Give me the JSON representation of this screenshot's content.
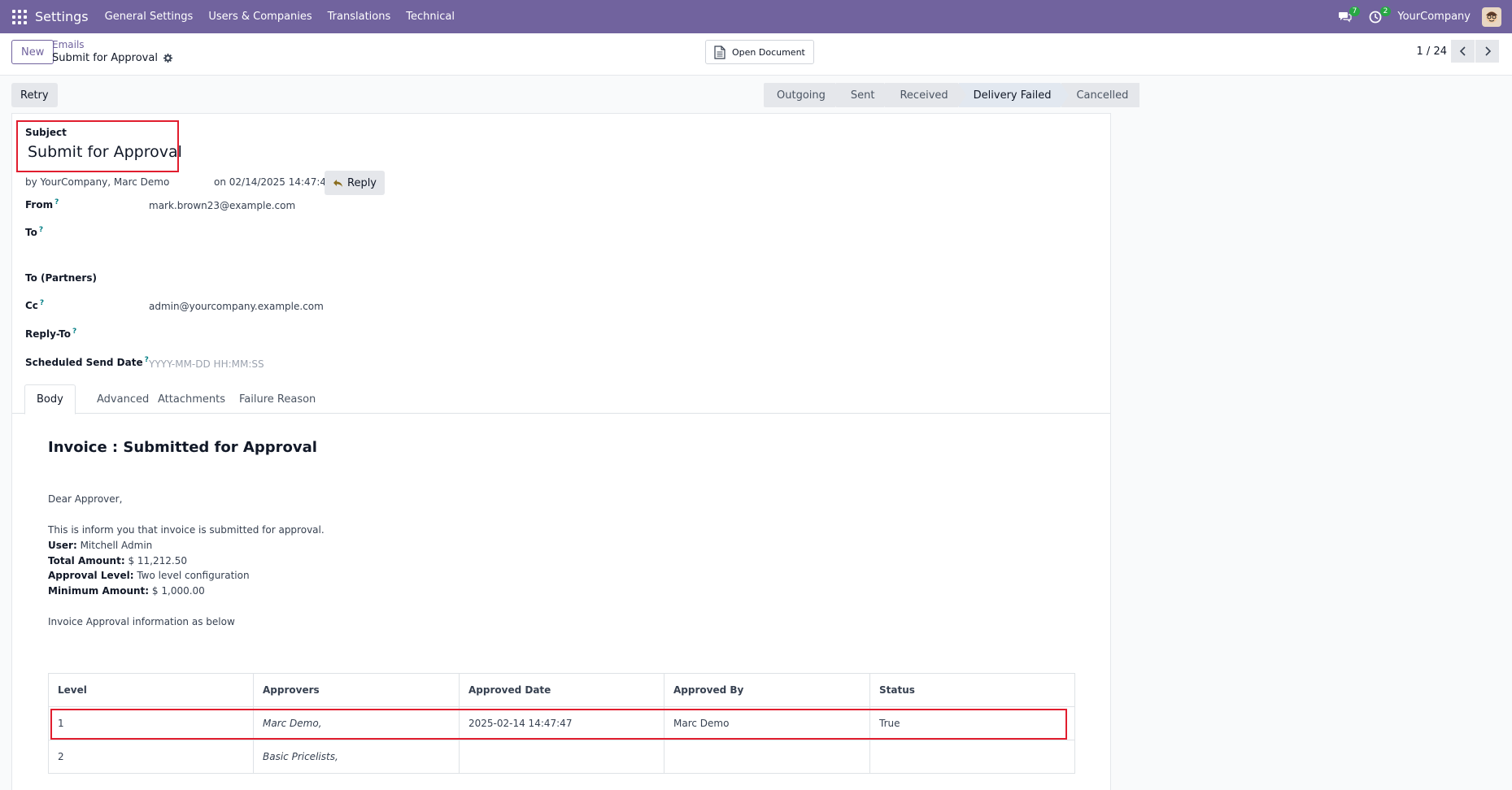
{
  "navbar": {
    "brand": "Settings",
    "menu": [
      "General Settings",
      "Users & Companies",
      "Translations",
      "Technical"
    ],
    "messages_count": "7",
    "activities_count": "2",
    "company": "YourCompany"
  },
  "control": {
    "new_label": "New",
    "breadcrumb_parent": "Emails",
    "breadcrumb_current": "Submit for Approval",
    "open_document_label": "Open Document",
    "pager": "1 / 24"
  },
  "actions": {
    "retry_label": "Retry"
  },
  "statusbar": {
    "stages": [
      "Outgoing",
      "Sent",
      "Received",
      "Delivery Failed",
      "Cancelled"
    ],
    "active": "Delivery Failed"
  },
  "form": {
    "subject_label": "Subject",
    "subject_value": "Submit for Approval",
    "by_line": "by  YourCompany, Marc Demo",
    "date_line": "on 02/14/2025 14:47:47",
    "reply_label": "Reply",
    "fields": {
      "from_label": "From",
      "from_value": "mark.brown23@example.com",
      "to_label": "To",
      "to_partners_label": "To (Partners)",
      "cc_label": "Cc",
      "cc_value": "admin@yourcompany.example.com",
      "reply_to_label": "Reply-To",
      "scheduled_label": "Scheduled Send Date",
      "scheduled_placeholder": "YYYY-MM-DD HH:MM:SS",
      "help_mark": "?"
    },
    "tabs": [
      "Body",
      "Advanced",
      "Attachments",
      "Failure Reason"
    ]
  },
  "body": {
    "title": "Invoice : Submitted for Approval",
    "greeting": "Dear Approver,",
    "intro": "This is inform you that invoice is submitted for approval.",
    "user_label": "User:",
    "user_value": " Mitchell Admin",
    "total_label": "Total Amount:",
    "total_value": " $ 11,212.50",
    "level_label": "Approval Level:",
    "level_value": " Two level configuration",
    "minimum_label": "Minimum Amount:",
    "minimum_value": " $ 1,000.00",
    "info_line": "Invoice Approval information as below",
    "table": {
      "headers": [
        "Level",
        "Approvers",
        "Approved Date",
        "Approved By",
        "Status"
      ],
      "rows": [
        [
          "1",
          "Marc Demo,",
          "2025-02-14 14:47:47",
          "Marc Demo",
          "True"
        ],
        [
          "2",
          "Basic Pricelists,",
          "",
          "",
          ""
        ]
      ]
    }
  }
}
